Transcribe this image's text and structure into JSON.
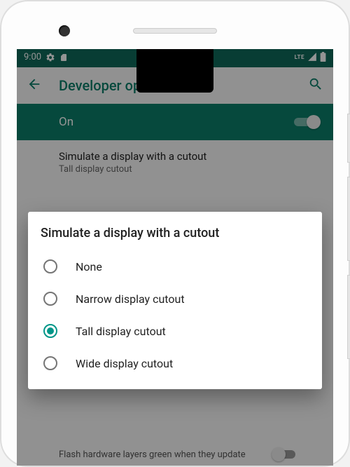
{
  "status": {
    "time": "9:00",
    "lte_text": "LTE"
  },
  "appbar": {
    "title": "Developer options"
  },
  "master_toggle": {
    "label": "On",
    "state": true
  },
  "current_setting": {
    "title": "Simulate a display with a cutout",
    "subtitle": "Tall display cutout"
  },
  "dialog": {
    "title": "Simulate a display with a cutout",
    "options": [
      {
        "label": "None",
        "selected": false
      },
      {
        "label": "Narrow display cutout",
        "selected": false
      },
      {
        "label": "Tall display cutout",
        "selected": true
      },
      {
        "label": "Wide display cutout",
        "selected": false
      }
    ]
  },
  "bg_item": {
    "text": "Flash hardware layers green when they update"
  },
  "colors": {
    "accent": "#009688",
    "appbar_text": "#0c7f6a",
    "toggle_bg": "#0c7f6a"
  }
}
